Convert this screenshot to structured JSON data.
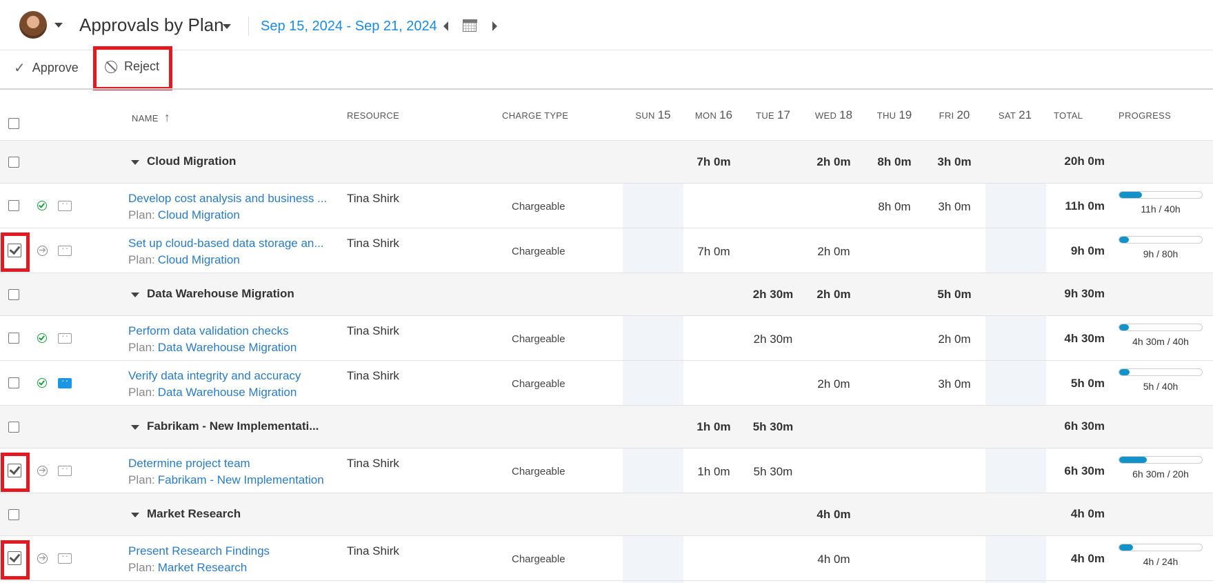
{
  "header": {
    "title": "Approvals by Plan",
    "date_range": "Sep 15, 2024 - Sep 21, 2024"
  },
  "toolbar": {
    "approve_label": "Approve",
    "reject_label": "Reject"
  },
  "columns": {
    "name": "NAME",
    "resource": "RESOURCE",
    "charge_type": "CHARGE TYPE",
    "days": [
      {
        "dow": "SUN",
        "num": "15"
      },
      {
        "dow": "MON",
        "num": "16"
      },
      {
        "dow": "TUE",
        "num": "17"
      },
      {
        "dow": "WED",
        "num": "18"
      },
      {
        "dow": "THU",
        "num": "19"
      },
      {
        "dow": "FRI",
        "num": "20"
      },
      {
        "dow": "SAT",
        "num": "21"
      }
    ],
    "total": "TOTAL",
    "progress": "PROGRESS"
  },
  "groups": [
    {
      "name": "Cloud Migration",
      "days": [
        "",
        "7h 0m",
        "",
        "2h 0m",
        "8h 0m",
        "3h 0m",
        ""
      ],
      "total": "20h 0m",
      "tasks": [
        {
          "name": "Develop cost analysis and business ...",
          "plan_prefix": "Plan:",
          "plan": "Cloud Migration",
          "resource": "Tina Shirk",
          "charge": "Chargeable",
          "days": [
            "",
            "",
            "",
            "",
            "8h 0m",
            "3h 0m",
            ""
          ],
          "total": "11h 0m",
          "progress": 0.275,
          "progress_label": "11h / 40h",
          "status": "approved",
          "comment": false,
          "checked": false
        },
        {
          "name": "Set up cloud-based data storage an...",
          "plan_prefix": "Plan:",
          "plan": "Cloud Migration",
          "resource": "Tina Shirk",
          "charge": "Chargeable",
          "days": [
            "",
            "7h 0m",
            "",
            "2h 0m",
            "",
            "",
            ""
          ],
          "total": "9h 0m",
          "progress": 0.1125,
          "progress_label": "9h / 80h",
          "status": "pending",
          "comment": false,
          "checked": true
        }
      ]
    },
    {
      "name": "Data Warehouse Migration",
      "days": [
        "",
        "",
        "2h 30m",
        "2h 0m",
        "",
        "5h 0m",
        ""
      ],
      "total": "9h 30m",
      "tasks": [
        {
          "name": "Perform data validation checks",
          "plan_prefix": "Plan:",
          "plan": "Data Warehouse Migration",
          "resource": "Tina Shirk",
          "charge": "Chargeable",
          "days": [
            "",
            "",
            "2h 30m",
            "",
            "",
            "2h 0m",
            ""
          ],
          "total": "4h 30m",
          "progress": 0.1125,
          "progress_label": "4h 30m / 40h",
          "status": "approved",
          "comment": false,
          "checked": false
        },
        {
          "name": "Verify data integrity and accuracy",
          "plan_prefix": "Plan:",
          "plan": "Data Warehouse Migration",
          "resource": "Tina Shirk",
          "charge": "Chargeable",
          "days": [
            "",
            "",
            "",
            "2h 0m",
            "",
            "3h 0m",
            ""
          ],
          "total": "5h 0m",
          "progress": 0.125,
          "progress_label": "5h / 40h",
          "status": "approved",
          "comment": true,
          "checked": false
        }
      ]
    },
    {
      "name": "Fabrikam - New Implementati...",
      "days": [
        "",
        "1h 0m",
        "5h 30m",
        "",
        "",
        "",
        ""
      ],
      "total": "6h 30m",
      "tasks": [
        {
          "name": "Determine project team",
          "plan_prefix": "Plan:",
          "plan": "Fabrikam - New Implementation",
          "resource": "Tina Shirk",
          "charge": "Chargeable",
          "days": [
            "",
            "1h 0m",
            "5h 30m",
            "",
            "",
            "",
            ""
          ],
          "total": "6h 30m",
          "progress": 0.33,
          "progress_label": "6h 30m / 20h",
          "status": "pending",
          "comment": false,
          "checked": true
        }
      ]
    },
    {
      "name": "Market Research",
      "days": [
        "",
        "",
        "",
        "4h 0m",
        "",
        "",
        ""
      ],
      "total": "4h 0m",
      "tasks": [
        {
          "name": "Present Research Findings",
          "plan_prefix": "Plan:",
          "plan": "Market Research",
          "resource": "Tina Shirk",
          "charge": "Chargeable",
          "days": [
            "",
            "",
            "",
            "4h 0m",
            "",
            "",
            ""
          ],
          "total": "4h 0m",
          "progress": 0.167,
          "progress_label": "4h / 24h",
          "status": "pending",
          "comment": false,
          "checked": true
        }
      ]
    }
  ]
}
